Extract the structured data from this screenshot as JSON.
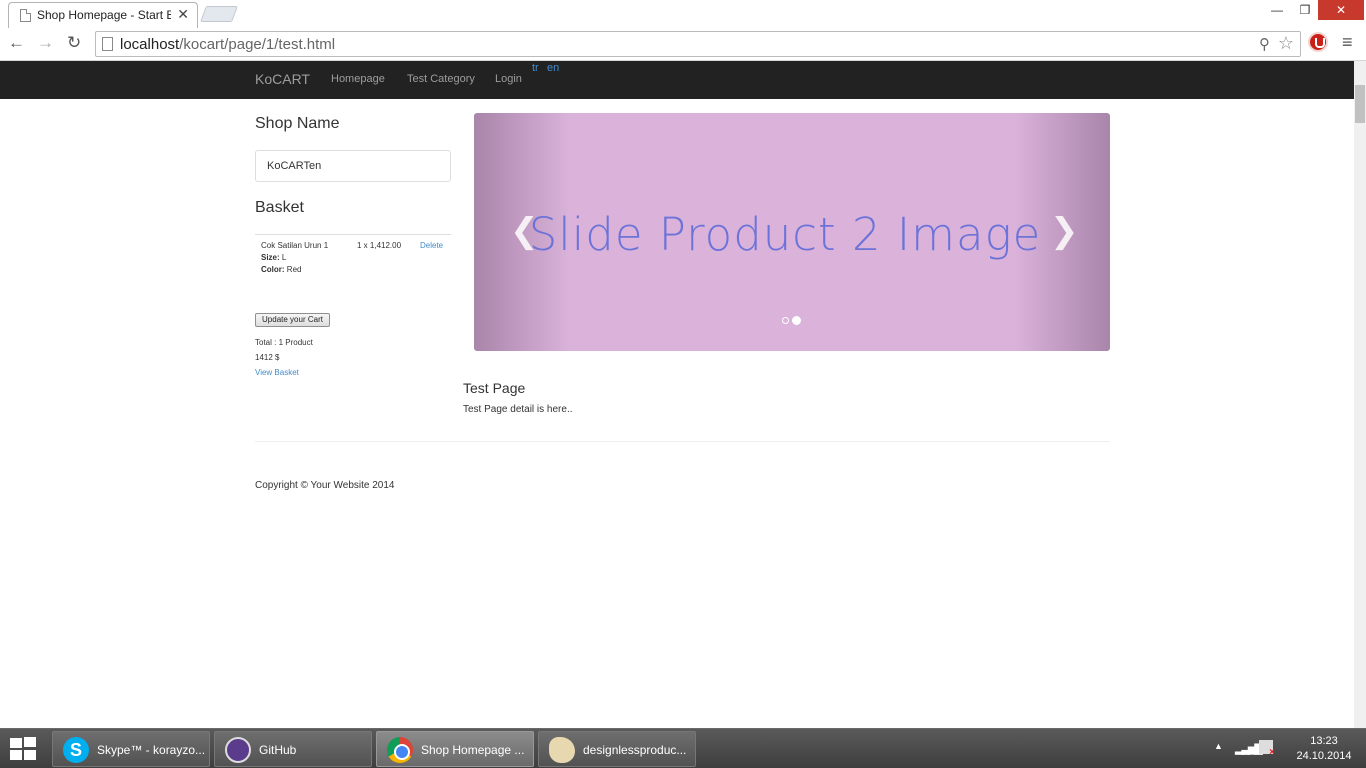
{
  "browser": {
    "tab_title": "Shop Homepage - Start Bo",
    "tab_close": "✕",
    "url_host": "localhost",
    "url_path": "/kocart/page/1/test.html",
    "window_min": "—",
    "window_max": "❐",
    "window_close": "✕",
    "nav_back": "←",
    "nav_forward": "→",
    "nav_reload": "↻",
    "search_glyph": "⚲",
    "star_glyph": "☆",
    "menu_glyph": "≡"
  },
  "navbar": {
    "brand": "KoCART",
    "links": [
      "Homepage",
      "Test Category",
      "Login"
    ],
    "languages": [
      "tr",
      "en"
    ]
  },
  "sidebar": {
    "shop_title": "Shop Name",
    "shop_name_value": "KoCARTen",
    "basket_title": "Basket",
    "item": {
      "name": "Cok Satilan Urun 1",
      "qty_price": "1 x 1,412.00",
      "delete_label": "Delete",
      "size_label": "Size:",
      "size_value": "L",
      "color_label": "Color:",
      "color_value": "Red"
    },
    "update_button": "Update your Cart",
    "total_products": "Total : 1 Product",
    "total_amount": "1412 $",
    "view_basket": "View Basket"
  },
  "carousel": {
    "slide_text": "Slide Product 2 Image",
    "prev_glyph": "❮",
    "next_glyph": "❯",
    "slide_count": 2,
    "active_slide": 2
  },
  "content": {
    "heading": "Test Page",
    "detail": "Test Page detail is here.."
  },
  "footer": {
    "copyright": "Copyright © Your Website 2014"
  },
  "taskbar": {
    "items": [
      {
        "label": "Skype™ - korayzo...",
        "icon": "skype-icon"
      },
      {
        "label": "GitHub",
        "icon": "github-icon"
      },
      {
        "label": "Shop Homepage ...",
        "icon": "chrome-icon"
      },
      {
        "label": "designlessproduc...",
        "icon": "paint-icon"
      }
    ],
    "skype_glyph": "S",
    "tray_arrow": "▲",
    "tray_signal": "▂▃▅▇",
    "time": "13:23",
    "date": "24.10.2014"
  },
  "colors": {
    "navbar_bg": "#222222",
    "link": "#428bca",
    "slide_bg": "#dab2da",
    "slide_text": "#6b73d8",
    "window_close": "#c7392d",
    "taskbar": "#4a4a4a"
  }
}
